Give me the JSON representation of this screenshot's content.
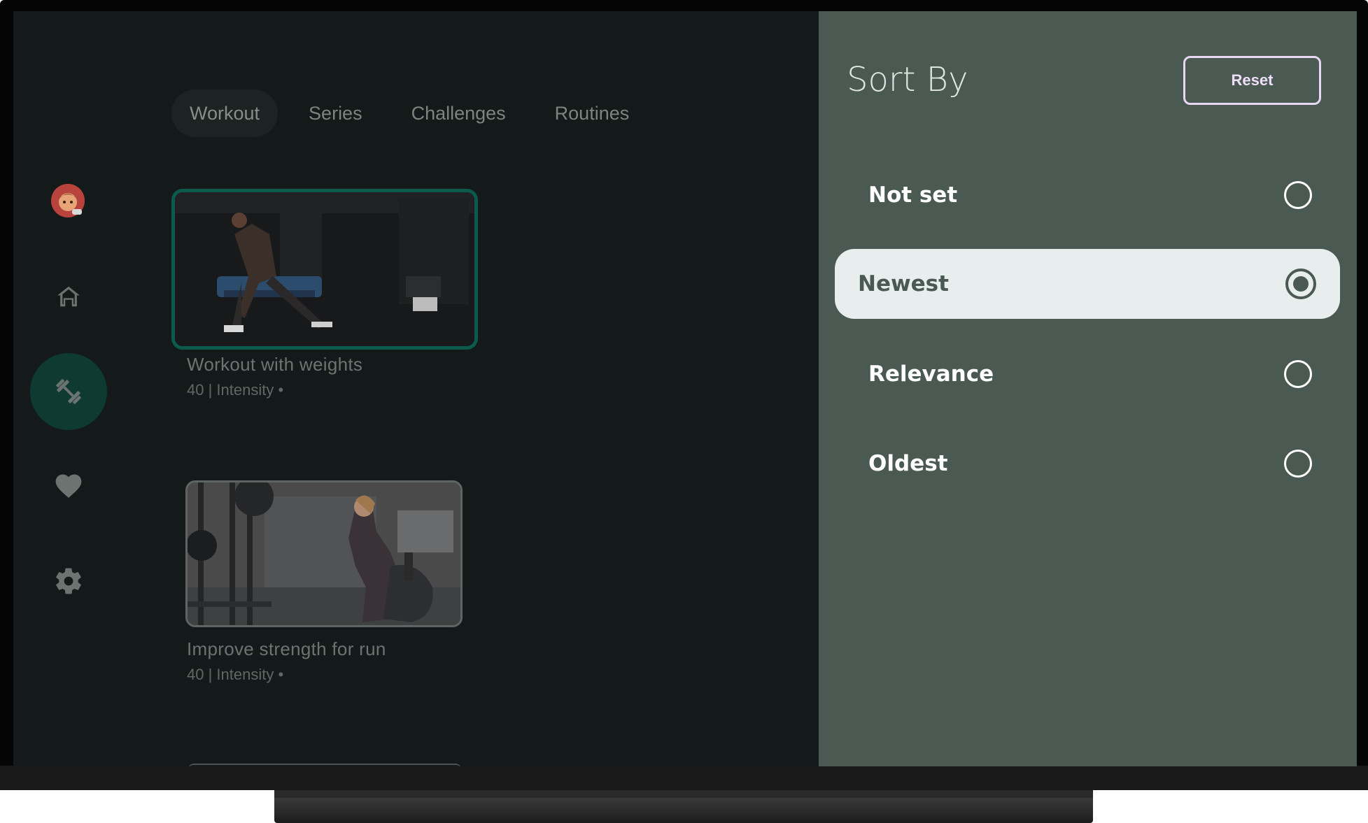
{
  "tabs": [
    {
      "label": "Workout",
      "active": true
    },
    {
      "label": "Series",
      "active": false
    },
    {
      "label": "Challenges",
      "active": false
    },
    {
      "label": "Routines",
      "active": false
    }
  ],
  "nav": {
    "items": [
      {
        "icon": "avatar-icon"
      },
      {
        "icon": "home-icon"
      },
      {
        "icon": "dumbbell-icon",
        "active": true
      },
      {
        "icon": "heart-icon"
      },
      {
        "icon": "gear-icon"
      }
    ]
  },
  "cards": [
    {
      "title": "Workout with weights",
      "meta": "40 | Intensity •",
      "focused": true
    },
    {
      "title": "Improve strength for run",
      "meta": "40 | Intensity •",
      "focused": false
    }
  ],
  "sort_panel": {
    "title": "Sort By",
    "reset_label": "Reset",
    "options": [
      {
        "label": "Not set",
        "selected": false
      },
      {
        "label": "Newest",
        "selected": true
      },
      {
        "label": "Relevance",
        "selected": false
      },
      {
        "label": "Oldest",
        "selected": false
      }
    ]
  },
  "colors": {
    "background": "#141a19",
    "panel": "#4a5a52",
    "accent": "#0e3a32",
    "focus_border": "#0b5a4c",
    "selected_option": "#e8edee",
    "reset_border": "#e8d7f2"
  }
}
